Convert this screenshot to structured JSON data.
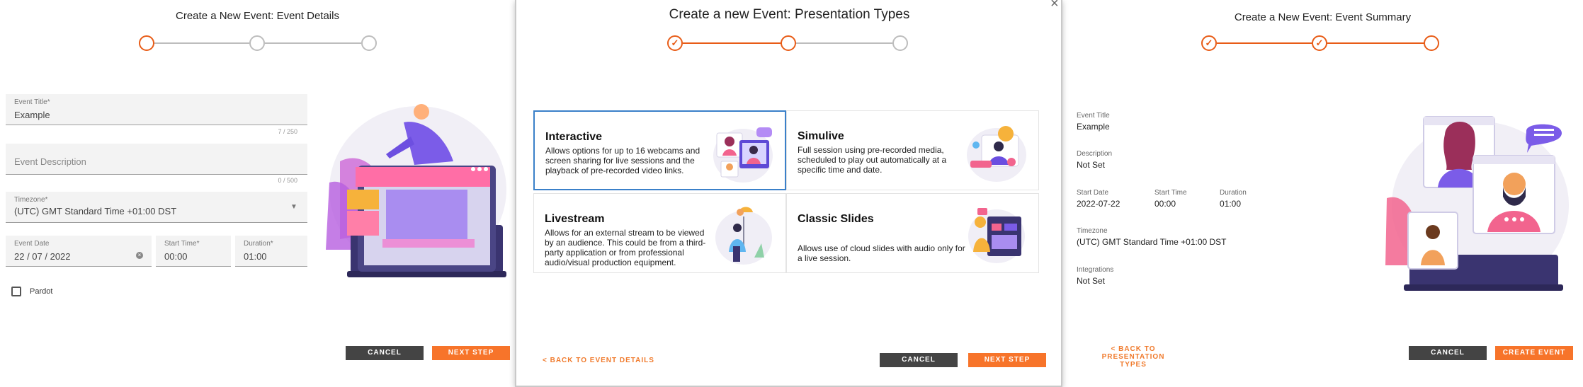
{
  "panel1": {
    "title": "Create a New Event: Event Details",
    "fields": {
      "event_title": {
        "label": "Event Title*",
        "value": "Example",
        "counter": "7 / 250"
      },
      "event_description": {
        "placeholder": "Event Description",
        "counter": "0 / 500"
      },
      "timezone": {
        "label": "Timezone*",
        "value": "(UTC) GMT Standard Time +01:00 DST"
      },
      "event_date": {
        "label": "Event Date",
        "value": "22 / 07 / 2022"
      },
      "start_time": {
        "label": "Start Time*",
        "value": "00:00"
      },
      "duration": {
        "label": "Duration*",
        "value": "01:00"
      }
    },
    "checkbox_label": "Pardot",
    "cancel_label": "CANCEL",
    "next_label": "NEXT STEP"
  },
  "panel2": {
    "title": "Create a new Event: Presentation Types",
    "cards": [
      {
        "title": "Interactive",
        "desc": "Allows options for up to 16 webcams and screen sharing for live sessions and the playback of pre-recorded video links.",
        "icon": "webcam-group-illustration"
      },
      {
        "title": "Simulive",
        "desc": "Full session using pre-recorded media, scheduled to play out automatically at a specific time and date.",
        "icon": "video-call-illustration"
      },
      {
        "title": "Livestream",
        "desc": "Allows for an external stream to be viewed by an audience. This could be from a third-party application or from professional audio/visual production equipment.",
        "icon": "presenter-illustration"
      },
      {
        "title": "Classic Slides",
        "desc": "Allows use of cloud slides with audio only for a live session.",
        "icon": "slides-illustration"
      }
    ],
    "back_label": "< BACK TO EVENT DETAILS",
    "cancel_label": "CANCEL",
    "next_label": "NEXT STEP"
  },
  "panel3": {
    "title": "Create a New Event: Event Summary",
    "summary": {
      "event_title_label": "Event Title",
      "event_title_value": "Example",
      "description_label": "Description",
      "description_value": "Not Set",
      "start_date_label": "Start Date",
      "start_date_value": "2022-07-22",
      "start_time_label": "Start Time",
      "start_time_value": "00:00",
      "duration_label": "Duration",
      "duration_value": "01:00",
      "timezone_label": "Timezone",
      "timezone_value": "(UTC) GMT Standard Time +01:00 DST",
      "integrations_label": "Integrations",
      "integrations_value": "Not Set"
    },
    "back_label_line1": "< BACK TO PRESENTATION",
    "back_label_line2": "TYPES",
    "cancel_label": "CANCEL",
    "create_label": "CREATE EVENT"
  },
  "colors": {
    "accent": "#e85c17",
    "button_orange": "#f7742a",
    "button_dark": "#444444",
    "selected_border": "#3a80c9"
  },
  "check_glyph": "✓",
  "close_glyph": "×"
}
